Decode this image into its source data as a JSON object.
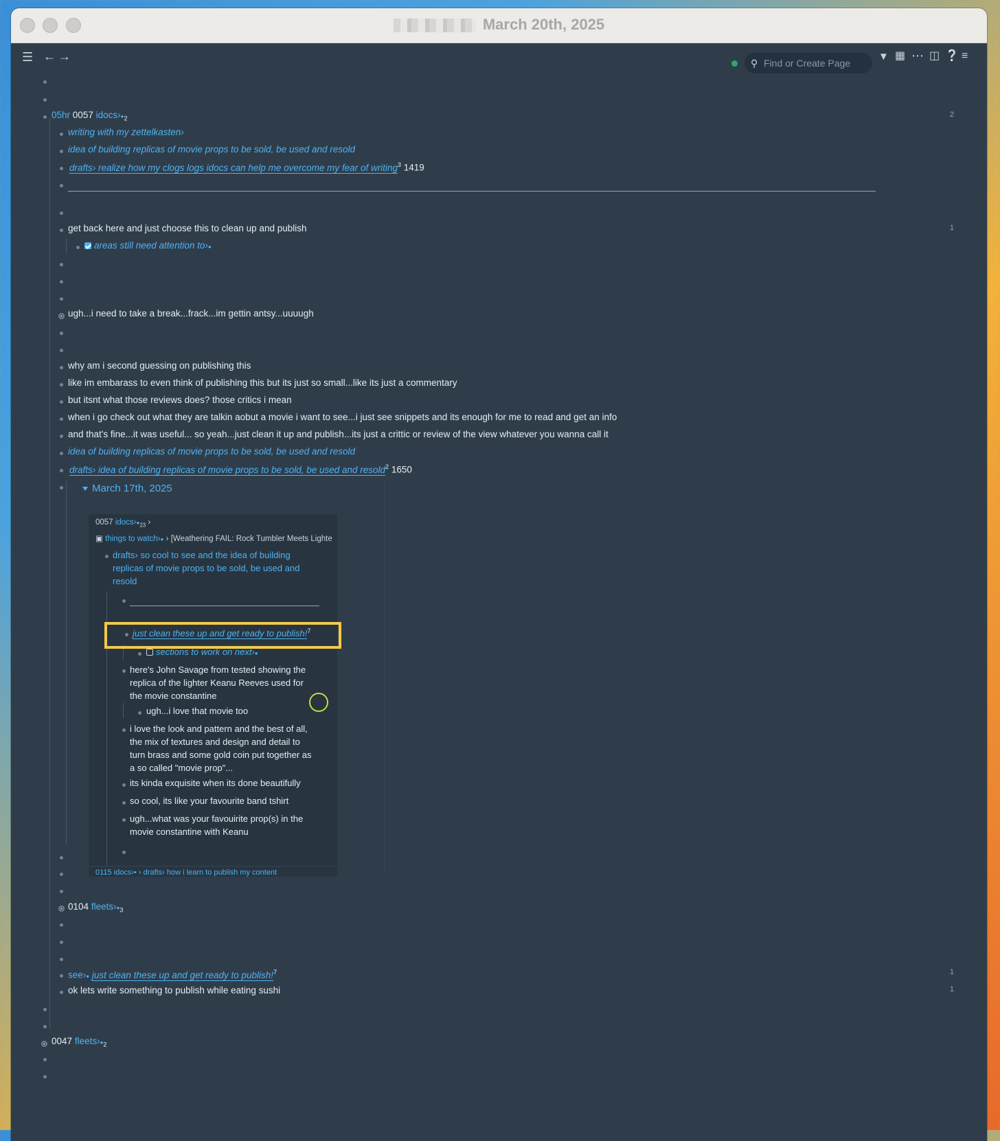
{
  "window": {
    "title": "March 20th, 2025"
  },
  "toolbar": {
    "search_placeholder": "Find or Create Page"
  },
  "blocks": {
    "hr05": {
      "time": "05hr",
      "code": "0057",
      "tag": "idocs›",
      "count": "2"
    },
    "c1": "writing with my zettelkasten›",
    "c2": "idea of building replicas of movie props to be sold, be used and resold",
    "c3": {
      "prefix": "drafts›",
      "text": "realize how my clogs logs idocs can help me overcome my fear of writing",
      "sup": "3",
      "num": "1419"
    },
    "r1": {
      "text": "get back here and just choose this to clean up and publish",
      "count": "1"
    },
    "r1a": "areas still need attention to›",
    "r2": "ugh...i need to take a break...frack...im gettin antsy...uuuugh",
    "r3": "why am i second guessing on publishing this",
    "r4": "like im embarass to even think of publishing this but its just so small...like its just a commentary",
    "r5": "but itsnt what those reviews does? those critics i mean",
    "r6": "when i go check out what they are talkin aobut a movie i want to see...i just see snippets and its enough for me to read and get an info",
    "r7": "and that's fine...it was useful... so yeah...just clean it up and publish...its just a crittic or review of the view whatever you wanna call it",
    "r8": "idea of building replicas of movie props to be sold, be used and resold",
    "r9": {
      "prefix": "drafts›",
      "text": "idea of building replicas of movie props to be sold, be used and resold",
      "sup": "2",
      "num": "1650"
    },
    "embed": {
      "date": "March 17th, 2025",
      "crumb1": {
        "code": "0057",
        "tag": "idocs›",
        "count": "23"
      },
      "crumb2": {
        "tag": "things to watch›",
        "title": "[Weathering FAIL: Rock Tumbler Meets Lighte"
      },
      "e1": [
        "drafts› so cool to see and the idea of building",
        "replicas of movie props to be sold, be used and",
        "resold"
      ],
      "e2": {
        "text": "just clean these up and get ready to publish!",
        "sup": "7"
      },
      "e3": "sections to work on next›",
      "e4": [
        "here's John Savage from tested showing the",
        "replica of the lighter Keanu Reeves used for",
        "the movie constantine"
      ],
      "e5": "ugh...i love that movie too",
      "e6": [
        "i love the look and pattern and the best of all,",
        "the mix of textures and design and detail to",
        "turn brass and some gold coin put together as",
        "a so called \"movie prop\"..."
      ],
      "e7": "its kinda exquisite when its done beautifully",
      "e8": "so cool, its like your favourite band tshirt",
      "e9": [
        "ugh...what was your favouirite prop(s) in the",
        "movie constantine with Keanu"
      ],
      "foot": "0115 idocs›• › drafts› how i learn to publish my content"
    },
    "f1": {
      "code": "0104",
      "tag": "fleets›",
      "count": "3"
    },
    "s1": {
      "prefix": "see›",
      "text": "just clean these up and get ready to publish!",
      "sup": "7",
      "count": "1"
    },
    "s2": {
      "text": "ok lets write something to publish while eating sushi",
      "count": "1"
    },
    "f2": {
      "code": "0047",
      "tag": "fleets›",
      "count": "2"
    }
  },
  "colors": {
    "link": "#4fb2f0",
    "highlight": "#f3c948",
    "bg": "#2f3d4b"
  }
}
